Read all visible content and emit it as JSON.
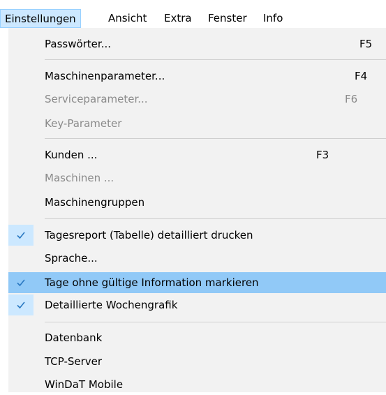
{
  "menubar": {
    "items": [
      {
        "label": "Einstellungen"
      },
      {
        "label": "Ansicht"
      },
      {
        "label": "Extra"
      },
      {
        "label": "Fenster"
      },
      {
        "label": "Info"
      }
    ]
  },
  "menu": {
    "items": [
      {
        "label": "Passwörter...",
        "shortcut": "F5",
        "enabled": true,
        "checked": false
      },
      {
        "label": "Maschinenparameter...",
        "shortcut": "F4",
        "enabled": true,
        "checked": false
      },
      {
        "label": "Serviceparameter...",
        "shortcut": "F6",
        "enabled": false,
        "checked": false
      },
      {
        "label": "Key-Parameter",
        "shortcut": "",
        "enabled": false,
        "checked": false
      },
      {
        "label": "Kunden ...",
        "shortcut": "F3",
        "enabled": true,
        "checked": false
      },
      {
        "label": "Maschinen ...",
        "shortcut": "",
        "enabled": false,
        "checked": false
      },
      {
        "label": "Maschinengruppen",
        "shortcut": "",
        "enabled": true,
        "checked": false
      },
      {
        "label": "Tagesreport (Tabelle) detailliert drucken",
        "shortcut": "",
        "enabled": true,
        "checked": true
      },
      {
        "label": "Sprache...",
        "shortcut": "",
        "enabled": true,
        "checked": false
      },
      {
        "label": "Tage ohne gültige Information markieren",
        "shortcut": "",
        "enabled": true,
        "checked": true,
        "highlighted": true
      },
      {
        "label": "Detaillierte Wochengrafik",
        "shortcut": "",
        "enabled": true,
        "checked": true
      },
      {
        "label": "Datenbank",
        "shortcut": "",
        "enabled": true,
        "checked": false
      },
      {
        "label": "TCP-Server",
        "shortcut": "",
        "enabled": true,
        "checked": false
      },
      {
        "label": "WinDaT Mobile",
        "shortcut": "",
        "enabled": true,
        "checked": false
      }
    ]
  },
  "colors": {
    "menubar_active": "#cce8ff",
    "highlight": "#91c9f7",
    "check": "#2b79c2",
    "menu_background": "#f2f2f2",
    "disabled_text": "#8a8a8a"
  },
  "icons": {
    "check": "checkmark-icon"
  }
}
